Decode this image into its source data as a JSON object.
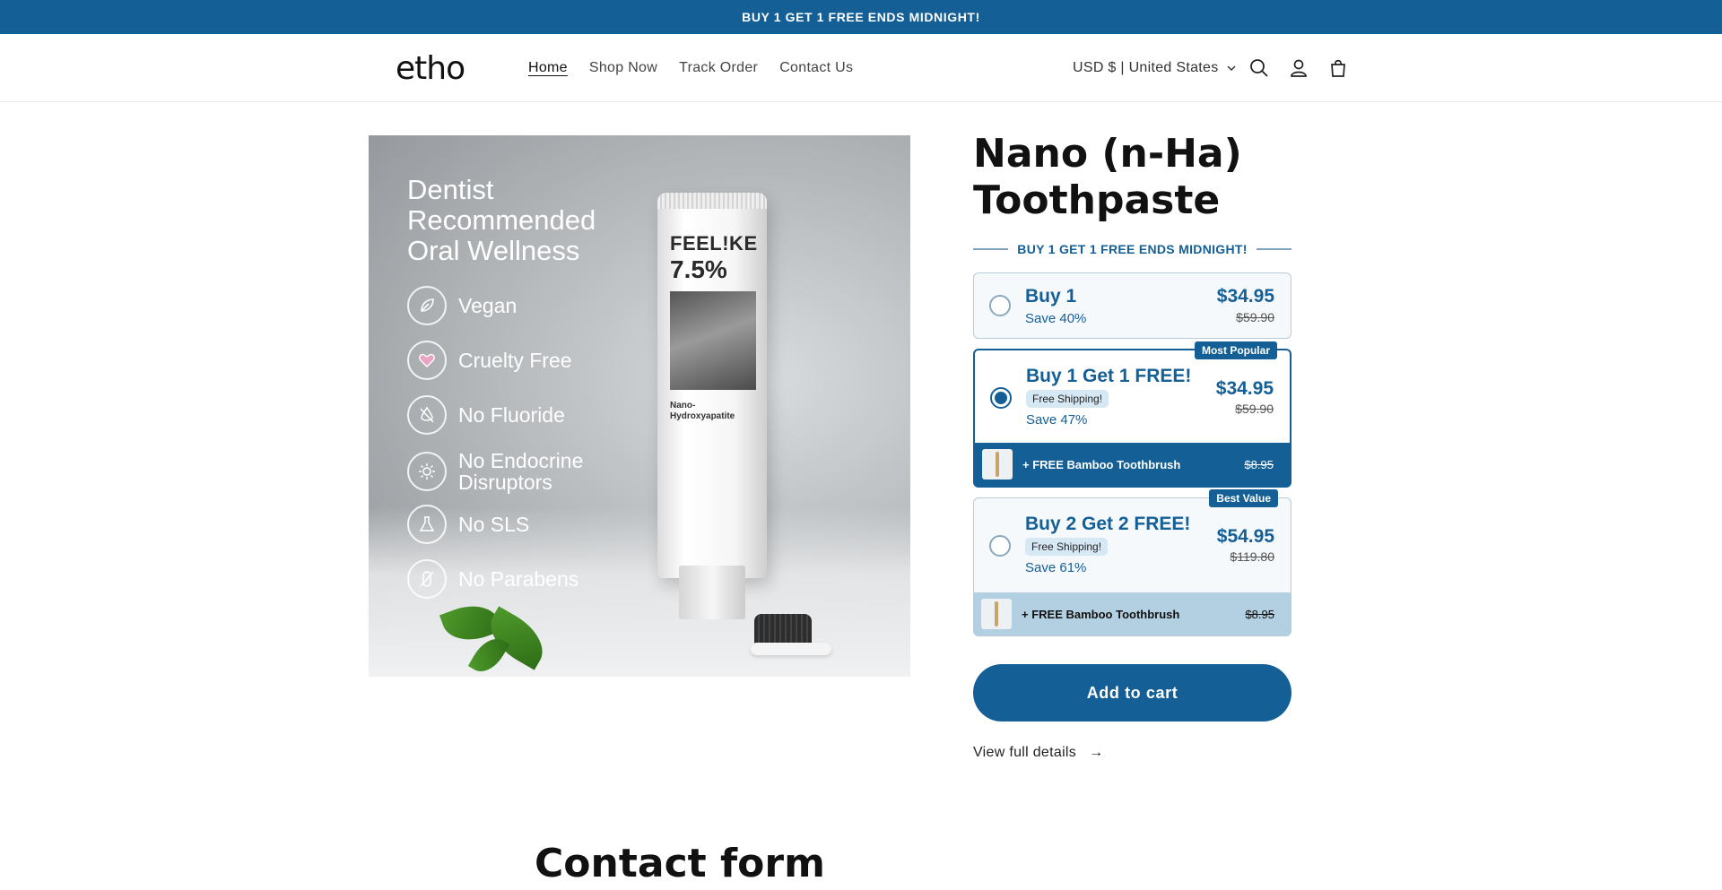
{
  "announcement": "BUY 1 GET 1 FREE ENDS MIDNIGHT!",
  "header": {
    "logo": "etho",
    "nav": [
      "Home",
      "Shop Now",
      "Track Order",
      "Contact Us"
    ],
    "locale": "USD $ | United States",
    "icons": [
      "search-icon",
      "account-icon",
      "cart-icon"
    ]
  },
  "media": {
    "headline": "Dentist Recommended Oral Wellness",
    "features": [
      "Vegan",
      "Cruelty Free",
      "No Fluoride",
      "No Endocrine Disruptors",
      "No SLS",
      "No Parabens"
    ],
    "tube_brand": "FEEL!KE",
    "tube_percent": "7.5%",
    "tube_text": "Nano-Hydroxyapatite"
  },
  "product": {
    "title": "Nano (n-Ha) Toothpaste",
    "promo": "BUY 1 GET 1 FREE ENDS MIDNIGHT!",
    "offers": [
      {
        "title": "Buy 1",
        "save": "Save 40%",
        "price": "$34.95",
        "compare": "$59.90",
        "selected": false
      },
      {
        "title": "Buy 1 Get 1 FREE!",
        "shipping": "Free Shipping!",
        "save": "Save 47%",
        "price": "$34.95",
        "compare": "$59.90",
        "badge": "Most Popular",
        "bonus": "+ FREE Bamboo Toothbrush",
        "bonus_price": "$8.95",
        "selected": true
      },
      {
        "title": "Buy 2 Get 2 FREE!",
        "shipping": "Free Shipping!",
        "save": "Save 61%",
        "price": "$54.95",
        "compare": "$119.80",
        "badge": "Best Value",
        "bonus": "+ FREE Bamboo Toothbrush",
        "bonus_price": "$8.95",
        "selected": false
      }
    ],
    "add_to_cart": "Add to cart",
    "view_details": "View full details",
    "arrow": "→"
  },
  "contact_heading": "Contact form",
  "colors": {
    "brand": "#145f96",
    "light_brand": "#b3cfe2"
  }
}
